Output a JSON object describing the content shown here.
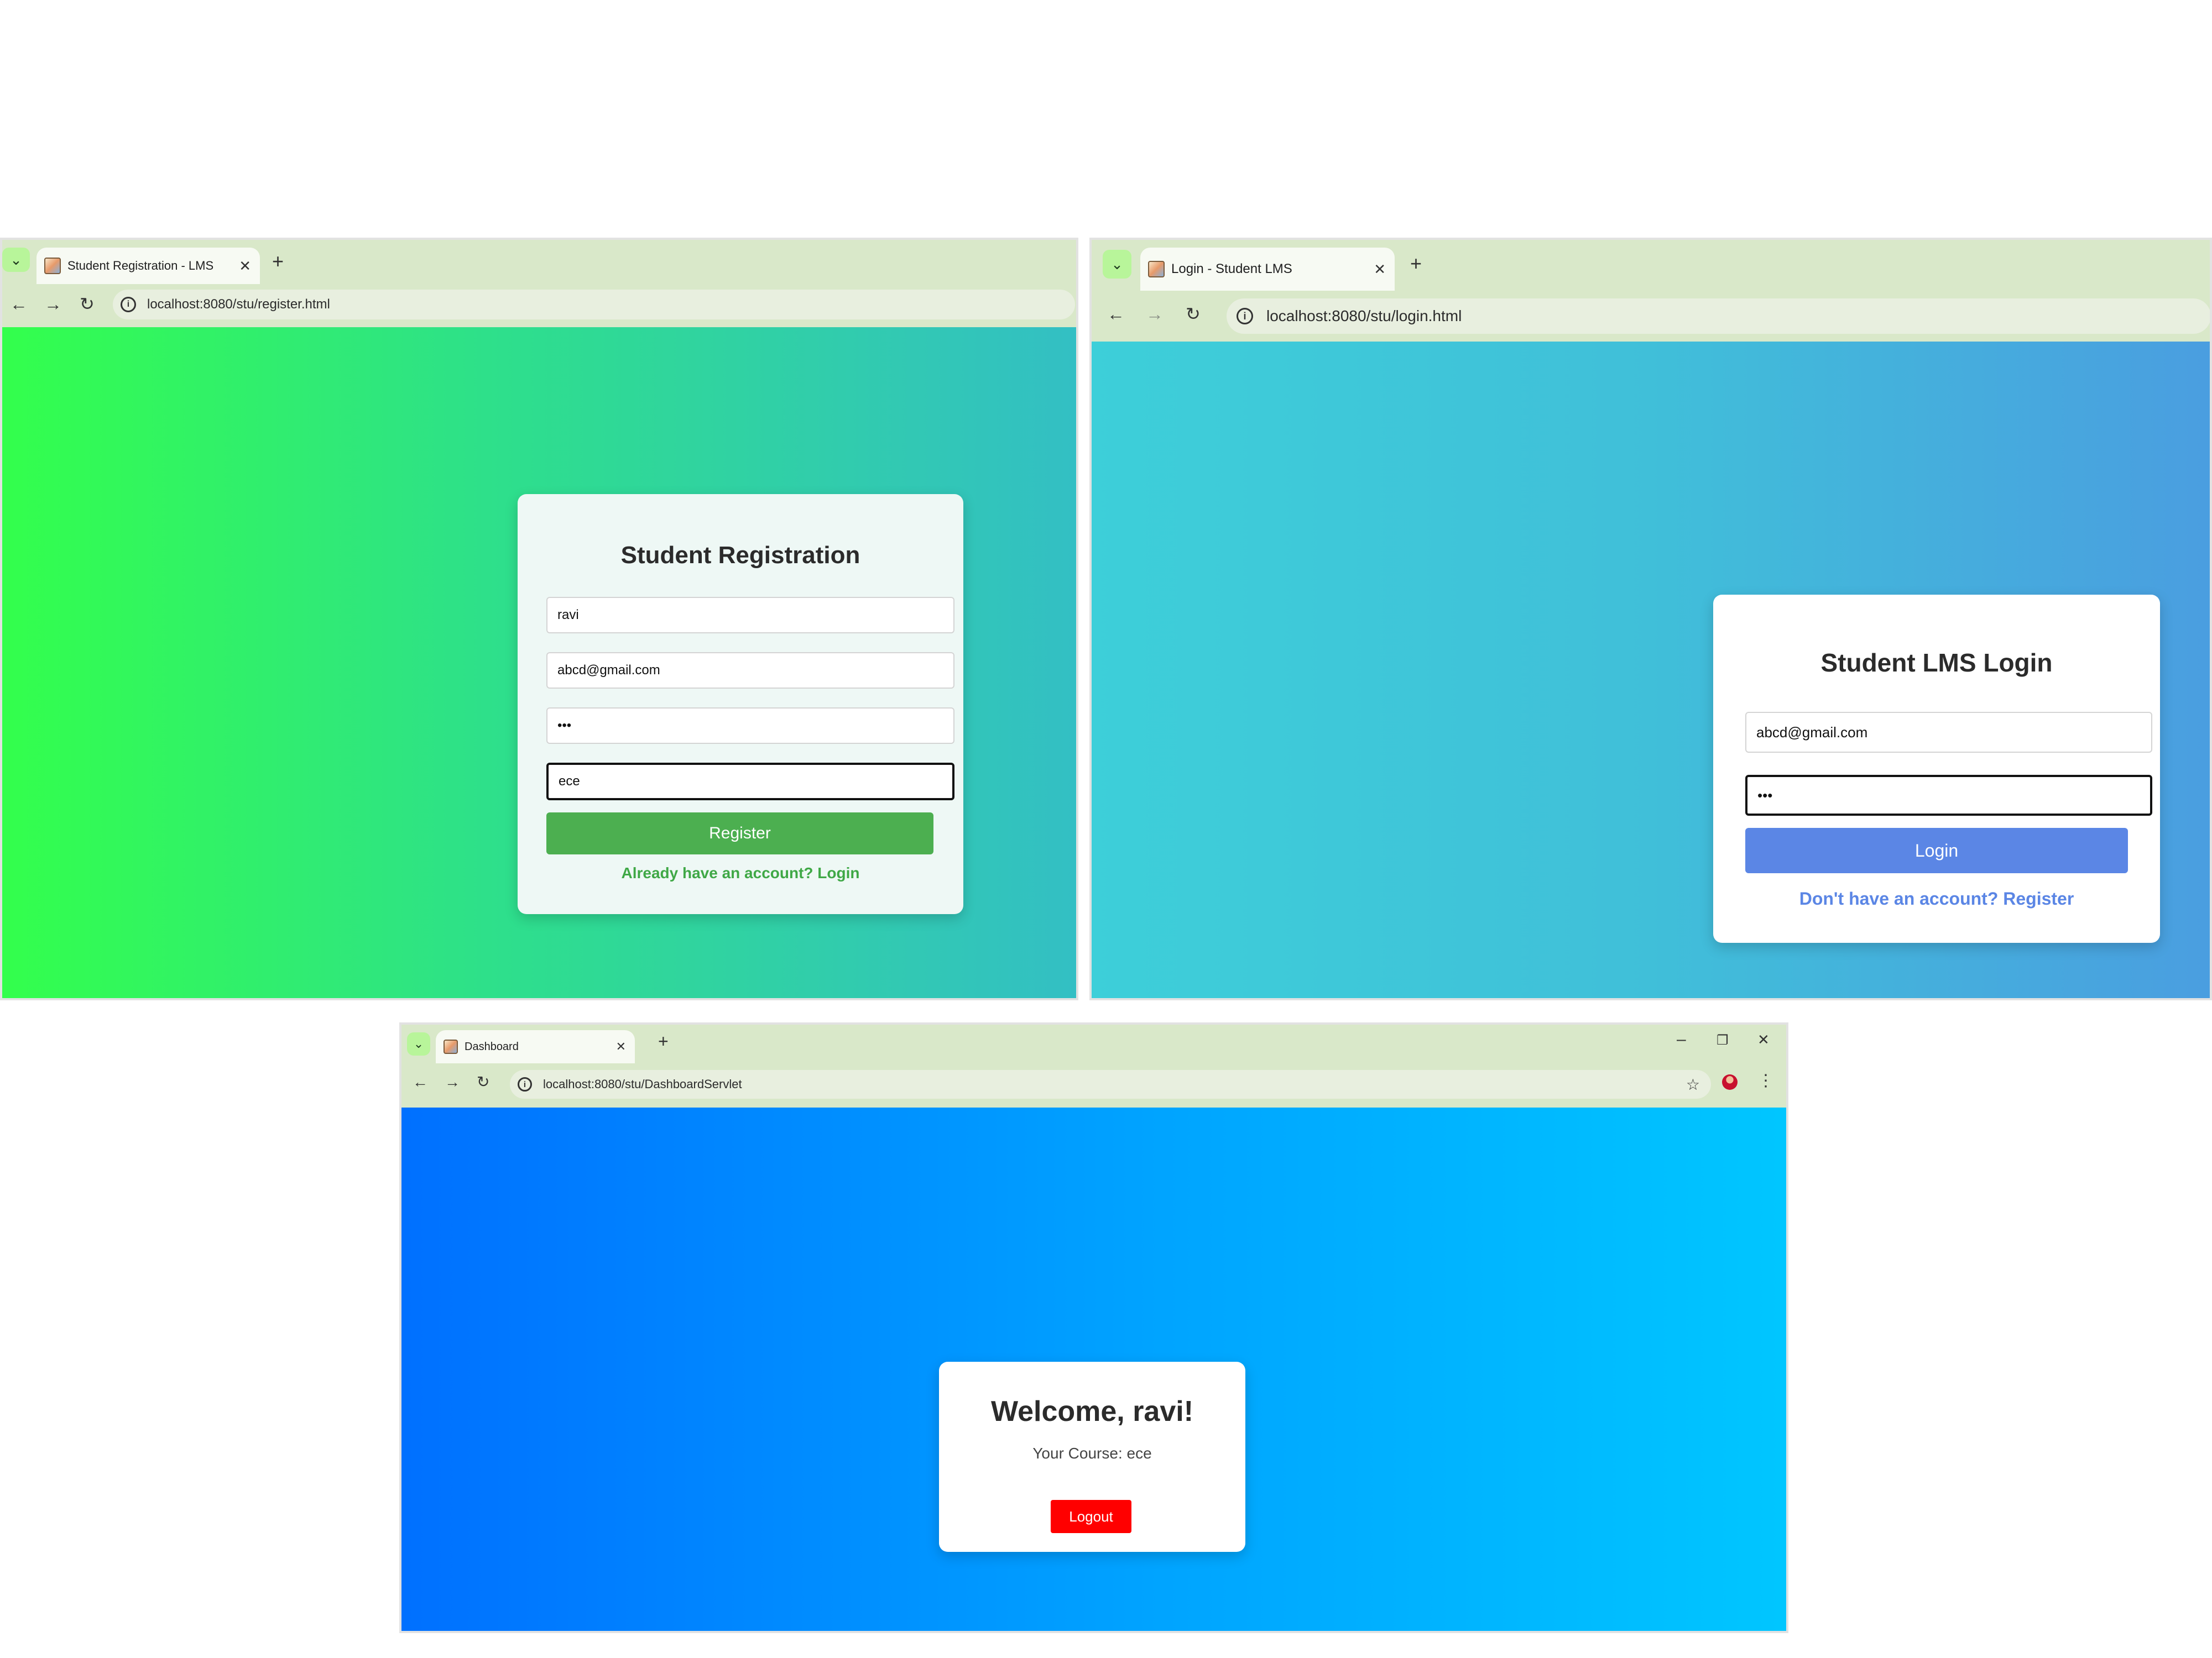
{
  "register_window": {
    "tab_title": "Student Registration - LMS",
    "url": "localhost:8080/stu/register.html",
    "form": {
      "title": "Student Registration",
      "name_value": "ravi",
      "email_value": "abcd@gmail.com",
      "password_value": "•••",
      "course_value": "ece",
      "submit_label": "Register",
      "login_link": "Already have an account? Login"
    }
  },
  "login_window": {
    "tab_title": "Login - Student LMS",
    "url": "localhost:8080/stu/login.html",
    "form": {
      "title": "Student LMS Login",
      "email_value": "abcd@gmail.com",
      "password_value": "•••",
      "submit_label": "Login",
      "register_link": "Don't have an account? Register"
    }
  },
  "dashboard_window": {
    "tab_title": "Dashboard",
    "url": "localhost:8080/stu/DashboardServlet",
    "card": {
      "welcome": "Welcome, ravi!",
      "course_line": "Your Course: ece",
      "logout_label": "Logout"
    }
  },
  "icons": {
    "tab_menu": "chevron-down-icon",
    "back": "arrow-left-icon",
    "forward": "arrow-right-icon",
    "reload": "reload-icon",
    "site_info": "info-icon",
    "close_tab": "close-icon",
    "new_tab": "plus-icon",
    "bookmark": "star-icon",
    "profile": "avatar",
    "menu": "kebab-menu-icon",
    "minimize": "minimize-icon",
    "restore": "restore-icon",
    "close_window": "close-window-icon"
  },
  "colors": {
    "register_gradient": [
      "#33ff4c",
      "#2ee08a",
      "#33bfc4"
    ],
    "login_gradient": [
      "#3dcfd9",
      "#40bfd9",
      "#4a9ee0"
    ],
    "dashboard_gradient": [
      "#0070ff",
      "#00a4ff",
      "#00c6ff"
    ],
    "register_button": "#4caf50",
    "login_button": "#5b86e5",
    "logout_button": "#ff0000",
    "browser_chrome": "#d9e8c9"
  }
}
